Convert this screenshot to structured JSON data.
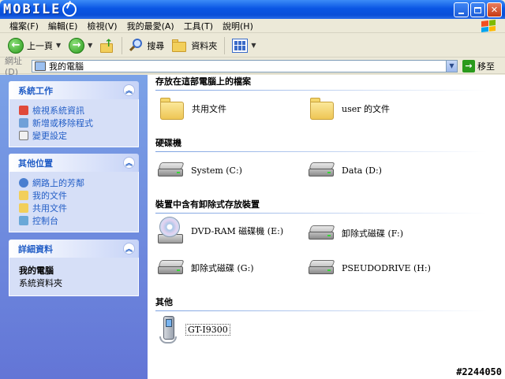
{
  "window": {
    "logo_text": "MOBILE",
    "buttons": {
      "minimize": "_",
      "maximize": "□",
      "close": "✕"
    }
  },
  "menu": [
    "檔案(F)",
    "編輯(E)",
    "檢視(V)",
    "我的最愛(A)",
    "工具(T)",
    "說明(H)"
  ],
  "toolbar": {
    "back_label": "上一頁",
    "search_label": "搜尋",
    "folders_label": "資料夾"
  },
  "address": {
    "label": "網址(D)",
    "value": "我的電腦",
    "go_label": "移至"
  },
  "sidebar": {
    "system_tasks": {
      "title": "系統工作",
      "items": [
        "檢視系統資訊",
        "新增或移除程式",
        "變更設定"
      ]
    },
    "other_places": {
      "title": "其他位置",
      "items": [
        "網路上的芳鄰",
        "我的文件",
        "共用文件",
        "控制台"
      ]
    },
    "details": {
      "title": "詳細資料",
      "name": "我的電腦",
      "type": "系統資料夾"
    }
  },
  "main": {
    "files_section": {
      "title": "存放在這部電腦上的檔案",
      "items": [
        "共用文件",
        "user 的文件"
      ]
    },
    "hdd_section": {
      "title": "硬碟機",
      "items": [
        "System (C:)",
        "Data (D:)"
      ]
    },
    "removable_section": {
      "title": "裝置中含有卸除式存放裝置",
      "items": [
        "DVD-RAM 磁碟機 (E:)",
        "卸除式磁碟 (F:)",
        "卸除式磁碟 (G:)",
        "PSEUDODRIVE (H:)"
      ]
    },
    "other_section": {
      "title": "其他",
      "items": [
        "GT-I9300"
      ]
    }
  },
  "watermark": "#2244050"
}
